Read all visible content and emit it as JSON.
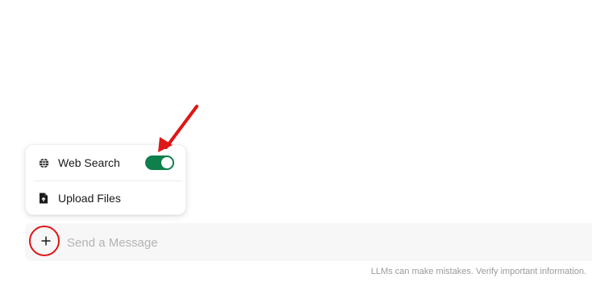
{
  "menu": {
    "items": [
      {
        "label": "Web Search",
        "icon": "globe-icon",
        "toggle_on": true
      },
      {
        "label": "Upload Files",
        "icon": "file-upload-icon"
      }
    ]
  },
  "composer": {
    "placeholder": "Send a Message",
    "add_icon": "plus-icon"
  },
  "footer": {
    "disclaimer": "LLMs can make mistakes. Verify important information."
  },
  "colors": {
    "toggle_on": "#0f7f4c",
    "annotation": "#e01515",
    "input_bg": "#f7f7f7"
  }
}
